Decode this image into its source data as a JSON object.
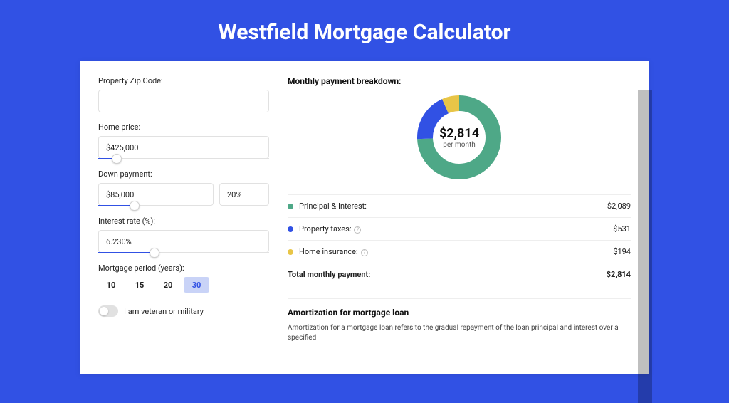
{
  "title": "Westfield Mortgage Calculator",
  "form": {
    "zip": {
      "label": "Property Zip Code:",
      "value": ""
    },
    "price": {
      "label": "Home price:",
      "value": "$425,000",
      "slider_pct": 8
    },
    "down": {
      "label": "Down payment:",
      "amount": "$85,000",
      "pct": "20%",
      "slider_pct": 20
    },
    "rate": {
      "label": "Interest rate (%):",
      "value": "6.230%",
      "slider_pct": 28
    },
    "period": {
      "label": "Mortgage period (years):",
      "options": [
        "10",
        "15",
        "20",
        "30"
      ],
      "active": "30"
    },
    "veteran": {
      "label": "I am veteran or military",
      "on": false
    }
  },
  "breakdown": {
    "title": "Monthly payment breakdown:",
    "center_amount": "$2,814",
    "center_sub": "per month",
    "rows": [
      {
        "color": "g",
        "name": "Principal & Interest:",
        "value": "$2,089"
      },
      {
        "color": "b",
        "name": "Property taxes:",
        "value": "$531",
        "info": true
      },
      {
        "color": "y",
        "name": "Home insurance:",
        "value": "$194",
        "info": true
      }
    ],
    "total": {
      "name": "Total monthly payment:",
      "value": "$2,814"
    }
  },
  "amort": {
    "title": "Amortization for mortgage loan",
    "text": "Amortization for a mortgage loan refers to the gradual repayment of the loan principal and interest over a specified"
  },
  "chart_data": {
    "type": "pie",
    "title": "Monthly payment breakdown",
    "series": [
      {
        "name": "Principal & Interest",
        "value": 2089,
        "color": "#4ea887"
      },
      {
        "name": "Property taxes",
        "value": 531,
        "color": "#3151e4"
      },
      {
        "name": "Home insurance",
        "value": 194,
        "color": "#e8c547"
      }
    ],
    "total": 2814,
    "center_label": "$2,814 per month"
  }
}
